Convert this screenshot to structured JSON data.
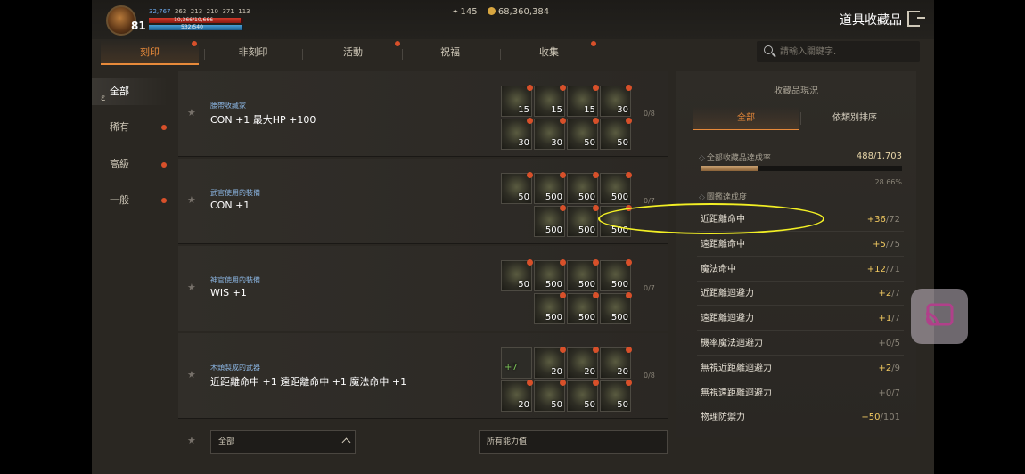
{
  "header": {
    "level": "81",
    "stats": {
      "s1": "32,767",
      "s2": "262",
      "s3": "213",
      "s4": "210",
      "s5": "371",
      "s6": "113"
    },
    "hp_text": "10,366/10,666",
    "hp_fraction": 0.97,
    "mp_text": "532/540",
    "mp_fraction": 0.98,
    "gems": "145",
    "gold": "68,360,384",
    "title": "道具收藏品"
  },
  "tabs": [
    {
      "label": "刻印",
      "active": true,
      "alert": true
    },
    {
      "label": "非刻印",
      "active": false,
      "alert": false
    },
    {
      "label": "活動",
      "active": false,
      "alert": true
    },
    {
      "label": "祝福",
      "active": false,
      "alert": false
    },
    {
      "label": "收集",
      "active": false,
      "alert": true
    }
  ],
  "search": {
    "placeholder": "請輸入關鍵字."
  },
  "sidebar": [
    {
      "label": "全部",
      "active": true,
      "alert": false
    },
    {
      "label": "稀有",
      "active": false,
      "alert": true
    },
    {
      "label": "高級",
      "active": false,
      "alert": true
    },
    {
      "label": "一般",
      "active": false,
      "alert": true
    }
  ],
  "rows": [
    {
      "name": "腰帶收藏家",
      "stat": "CON +1 最大HP +100",
      "count": "0/8",
      "slots": [
        {
          "qty": "15"
        },
        {
          "qty": "15"
        },
        {
          "qty": "15"
        },
        {
          "qty": "30"
        },
        {
          "qty": "30"
        },
        {
          "qty": "30"
        },
        {
          "qty": "50"
        },
        {
          "qty": "50"
        }
      ]
    },
    {
      "name": "武官使用的裝備",
      "stat": "CON +1",
      "count": "0/7",
      "slots": [
        {
          "qty": "50"
        },
        {
          "qty": "500"
        },
        {
          "qty": "500"
        },
        {
          "qty": "500"
        },
        {
          "qty": "500"
        },
        {
          "qty": "500"
        },
        {
          "qty": "500"
        }
      ]
    },
    {
      "name": "神官使用的裝備",
      "stat": "WIS +1",
      "count": "0/7",
      "slots": [
        {
          "qty": "50"
        },
        {
          "qty": "500"
        },
        {
          "qty": "500"
        },
        {
          "qty": "500"
        },
        {
          "qty": "500"
        },
        {
          "qty": "500"
        },
        {
          "qty": "500"
        }
      ]
    },
    {
      "name": "木頭製成的武器",
      "stat": "近距離命中 +1 遠距離命中 +1 魔法命中 +1",
      "count": "0/8",
      "slots": [
        {
          "qty": "+7",
          "green": true
        },
        {
          "qty": "20"
        },
        {
          "qty": "20"
        },
        {
          "qty": "20"
        },
        {
          "qty": "20"
        },
        {
          "qty": "50"
        },
        {
          "qty": "50"
        },
        {
          "qty": "50"
        }
      ]
    }
  ],
  "footer": {
    "filter_left": "全部",
    "filter_right": "所有能力值"
  },
  "panel": {
    "title": "收藏品現況",
    "tabs": [
      "全部",
      "依類別排序"
    ],
    "overall_label": "全部收藏品達成率",
    "overall_value": "488/1,703",
    "overall_pct": "28.66%",
    "overall_fraction": 0.2866,
    "section_label": "圖鑑達成度",
    "stats": [
      {
        "name": "近距離命中",
        "cur": "+36",
        "max": "/72"
      },
      {
        "name": "遠距離命中",
        "cur": "+5",
        "max": "/75"
      },
      {
        "name": "魔法命中",
        "cur": "+12",
        "max": "/71"
      },
      {
        "name": "近距離迴避力",
        "cur": "+2",
        "max": "/7"
      },
      {
        "name": "遠距離迴避力",
        "cur": "+1",
        "max": "/7"
      },
      {
        "name": "機率魔法迴避力",
        "cur": "+0",
        "max": "/5"
      },
      {
        "name": "無視近距離迴避力",
        "cur": "+2",
        "max": "/9"
      },
      {
        "name": "無視遠距離迴避力",
        "cur": "+0",
        "max": "/7"
      },
      {
        "name": "物理防禦力",
        "cur": "+50",
        "max": "/101"
      }
    ]
  },
  "colors": {
    "accent": "#e88a3a",
    "alert": "#d8502a",
    "highlight": "#f2ef24",
    "positive": "#f0c860"
  }
}
